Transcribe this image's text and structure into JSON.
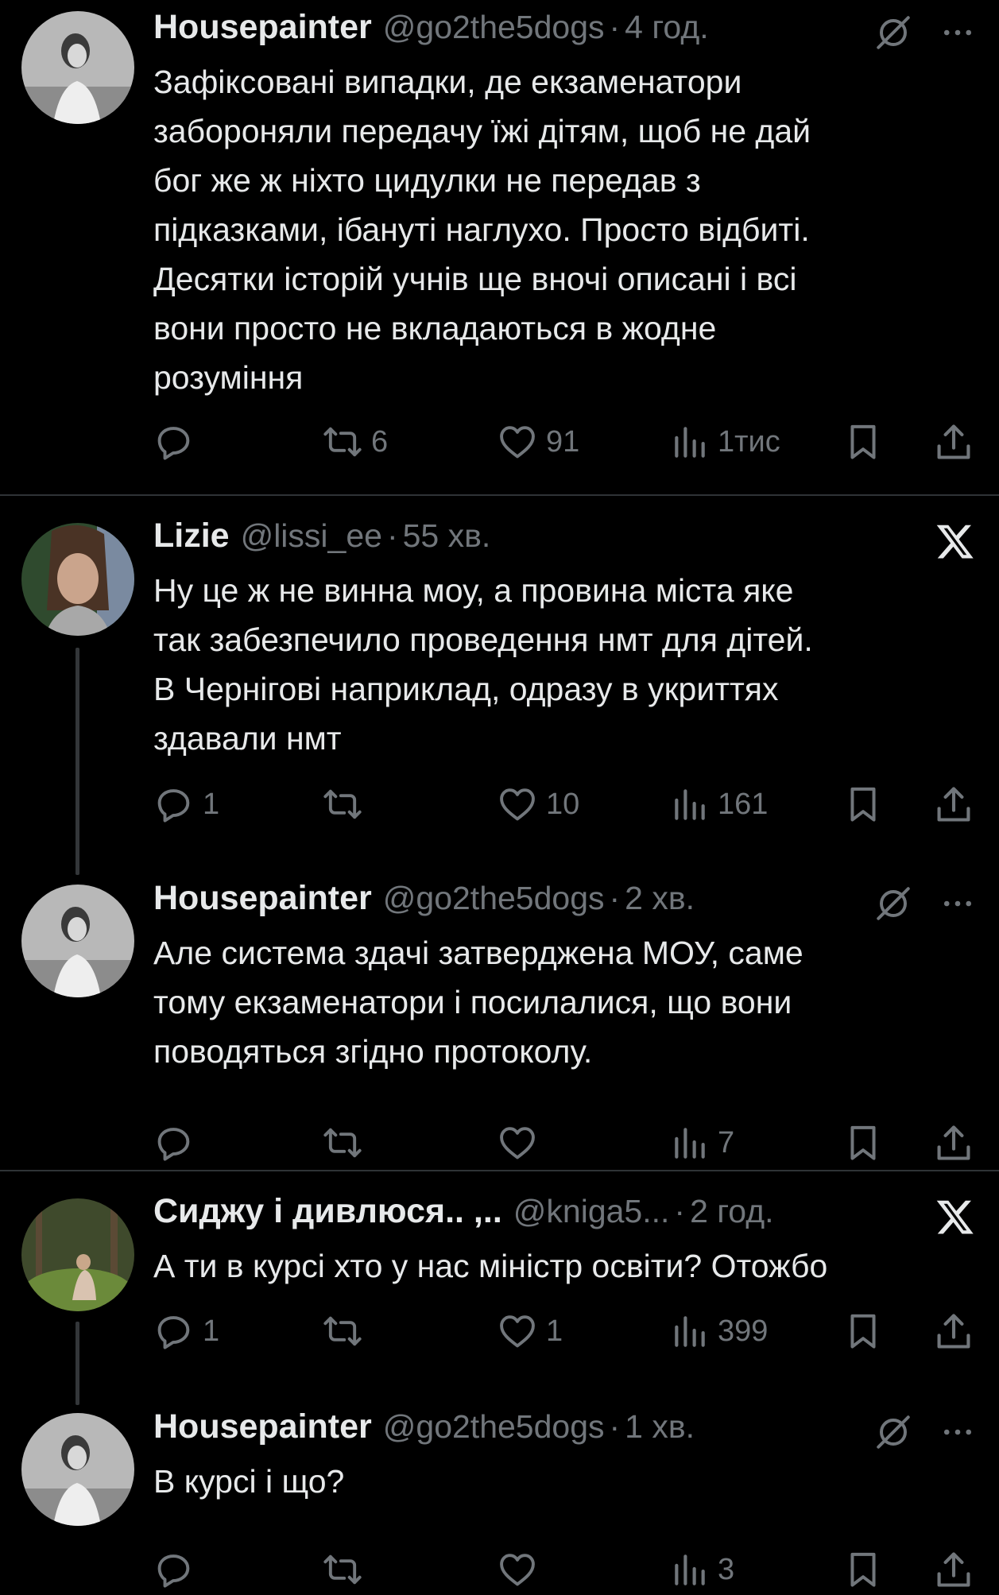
{
  "tweets": [
    {
      "name": "Housepainter",
      "handle": "@go2the5dogs",
      "sep": "·",
      "time": "4 год.",
      "text": "Зафіксовані випадки, де екзаменатори\nзабороняли передачу їжі дітям, щоб не дай\nбог же ж ніхто цидулки не передав з\nпідказками, ібануті наглухо. Просто відбиті.\nДесятки історій учнів ще вночі описані і всі\nвони просто не вкладаються в жодне\nрозуміння",
      "replies": "",
      "retweets": "6",
      "likes": "91",
      "views": "1тис"
    },
    {
      "name": "Lizie",
      "handle": "@lissi_ee",
      "sep": "·",
      "time": "55 хв.",
      "text": "Ну це ж не винна моу, а провина міста яке\nтак забезпечило проведення нмт для дітей.\nВ Чернігові наприклад, одразу в укриттях\nздавали нмт",
      "replies": "1",
      "retweets": "",
      "likes": "10",
      "views": "161"
    },
    {
      "name": "Housepainter",
      "handle": "@go2the5dogs",
      "sep": "·",
      "time": "2 хв.",
      "text": "Але система здачі затверджена МОУ, саме\nтому екзаменатори і посилалися, що вони\nповодяться згідно протоколу.",
      "replies": "",
      "retweets": "",
      "likes": "",
      "views": "7"
    },
    {
      "name": "Сиджу і дивлюся.. ,..",
      "handle": "@kniga5...",
      "sep": "·",
      "time": "2 год.",
      "text": "А ти в курсі хто у нас міністр освіти? Отожбо",
      "replies": "1",
      "retweets": "",
      "likes": "1",
      "views": "399"
    },
    {
      "name": "Housepainter",
      "handle": "@go2the5dogs",
      "sep": "·",
      "time": "1 хв.",
      "text": "В курсі і що?",
      "replies": "",
      "retweets": "",
      "likes": "",
      "views": "3"
    }
  ],
  "icons": {
    "reply": "reply-icon",
    "retweet": "retweet-icon",
    "like": "heart-icon",
    "views": "views-chart-icon",
    "bookmark": "bookmark-icon",
    "share": "share-icon",
    "noverify": "slashed-circle-icon",
    "more": "more-dots-icon",
    "x_logo": "x-logo-icon"
  },
  "colors": {
    "background": "#000000",
    "text": "#e7e9ea",
    "muted": "#71767b",
    "divider": "#2f3336"
  }
}
